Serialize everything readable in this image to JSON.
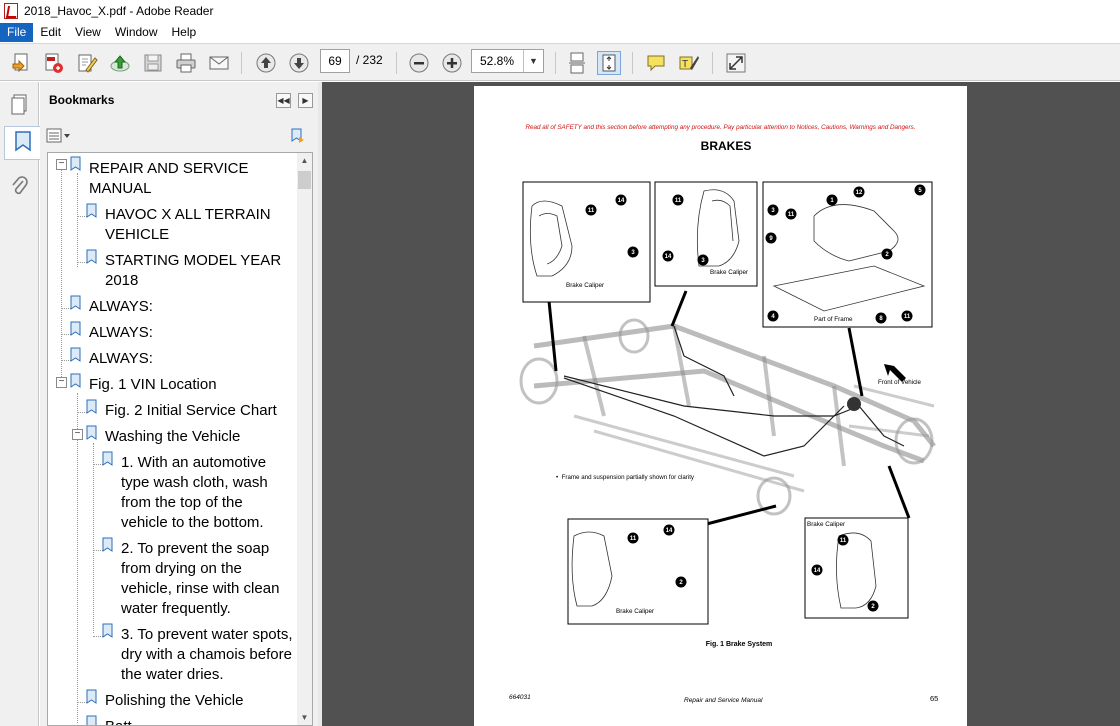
{
  "window": {
    "title": "2018_Havoc_X.pdf - Adobe Reader"
  },
  "menu": {
    "items": [
      "File",
      "Edit",
      "View",
      "Window",
      "Help"
    ],
    "active": "File"
  },
  "toolbar": {
    "page_current": "69",
    "page_total": "/  232",
    "zoom": "52.8%",
    "icons": [
      "create-pdf-icon",
      "export-icon",
      "edit-icon",
      "upload-icon",
      "save-icon",
      "print-icon",
      "email-icon",
      "previous-page-icon",
      "next-page-icon",
      "zoom-out-icon",
      "zoom-in-icon",
      "scroll-mode-icon",
      "fit-page-icon",
      "comment-icon",
      "highlight-icon",
      "full-screen-icon"
    ]
  },
  "bookmarks_panel": {
    "title": "Bookmarks",
    "items": [
      {
        "line1": "REPAIR AND SERVICE",
        "line2": "MANUAL"
      },
      {
        "line1": "HAVOC X ALL TERRAIN",
        "line2": "VEHICLE"
      },
      {
        "line1": "STARTING MODEL YEAR",
        "line2": "2018"
      },
      {
        "line1": "ALWAYS:"
      },
      {
        "line1": "ALWAYS:"
      },
      {
        "line1": "ALWAYS:"
      },
      {
        "line1": "Fig. 1 VIN Location"
      },
      {
        "line1": "Fig. 2 Initial Service Chart"
      },
      {
        "line1": "Washing the Vehicle"
      },
      {
        "line1": "1. With an automotive",
        "line2": "type wash cloth, wash",
        "line3": "from the top of the",
        "line4": "vehicle to the bottom."
      },
      {
        "line1": "2. To prevent the soap",
        "line2": "from drying on the",
        "line3": "vehicle, rinse with clean",
        "line4": "water frequently."
      },
      {
        "line1": "3. To prevent water spots,",
        "line2": "dry with a chamois before",
        "line3": "the water dries."
      },
      {
        "line1": "Polishing the Vehicle"
      },
      {
        "line1": "Batt"
      }
    ]
  },
  "document": {
    "warning": "Read all of SAFETY and this section before attempting any procedure. Pay particular attention to Notices, Cautions, Warnings and Dangers.",
    "heading": "BRAKES",
    "caption": "Fig. 1  Brake System",
    "note": "Frame and suspension partially shown for clarity",
    "front_label": "Front of Vehicle",
    "labels": {
      "brake_caliper": "Brake Caliper",
      "part_of_frame": "Part of Frame"
    },
    "footer_left": "664031",
    "footer_center": "Repair and Service Manual",
    "footer_right": "65"
  }
}
